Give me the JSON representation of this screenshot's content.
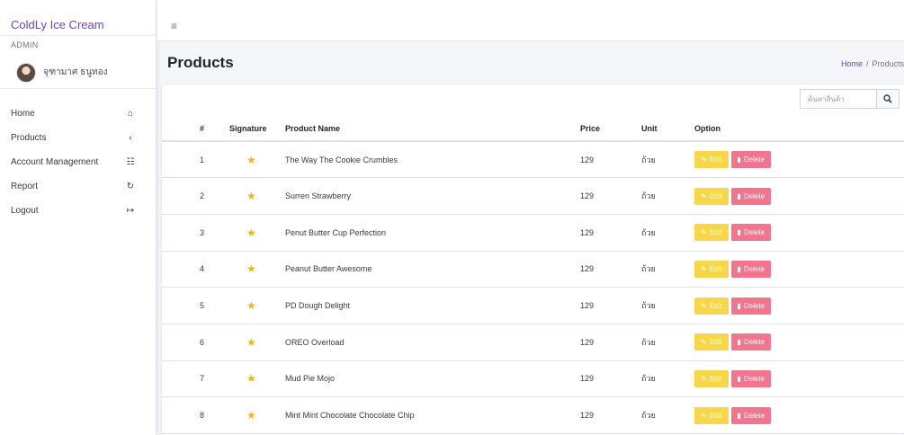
{
  "app": {
    "brand": "ColdLy Ice Cream"
  },
  "user": {
    "role": "ADMIN",
    "name": "จุฑามาศ ธนูทอง"
  },
  "sidebar": {
    "items": [
      {
        "label": "Home",
        "icon": "home-icon",
        "glyph": "⌂"
      },
      {
        "label": "Products",
        "icon": "chevron-left-icon",
        "glyph": "‹"
      },
      {
        "label": "Account Management",
        "icon": "users-icon",
        "glyph": "☷"
      },
      {
        "label": "Report",
        "icon": "history-icon",
        "glyph": "↻"
      },
      {
        "label": "Logout",
        "icon": "sign-out-icon",
        "glyph": "↦"
      }
    ]
  },
  "topbar": {
    "menu_icon": "hamburger-icon",
    "menu_glyph": "≡"
  },
  "page": {
    "title": "Products",
    "breadcrumb": {
      "home": "Home",
      "separator": "/",
      "current": "Products"
    }
  },
  "search": {
    "placeholder": "ค้นหาสินค้า",
    "value": ""
  },
  "table": {
    "headers": {
      "num": "#",
      "signature": "Signature",
      "name": "Product Name",
      "price": "Price",
      "unit": "Unit",
      "option": "Option"
    },
    "edit_label": "Edit",
    "delete_label": "Delete",
    "rows": [
      {
        "num": "1",
        "name": "The Way The Cookie Crumbles",
        "price": "129",
        "unit": "ถ้วย"
      },
      {
        "num": "2",
        "name": "Surren Strawberry",
        "price": "129",
        "unit": "ถ้วย"
      },
      {
        "num": "3",
        "name": "Penut Butter Cup Perfection",
        "price": "129",
        "unit": "ถ้วย"
      },
      {
        "num": "4",
        "name": "Peanut Butter Awesome",
        "price": "129",
        "unit": "ถ้วย"
      },
      {
        "num": "5",
        "name": "PD Dough Delight",
        "price": "129",
        "unit": "ถ้วย"
      },
      {
        "num": "6",
        "name": "OREO Overload",
        "price": "129",
        "unit": "ถ้วย"
      },
      {
        "num": "7",
        "name": "Mud Pie Mojo",
        "price": "129",
        "unit": "ถ้วย"
      },
      {
        "num": "8",
        "name": "Mint Mint Chocolate Chocolate Chip",
        "price": "129",
        "unit": "ถ้วย"
      }
    ]
  },
  "colors": {
    "accent": "#6f42c1",
    "edit": "#f7d64a",
    "delete": "#f2748d",
    "star": "#f2b705"
  }
}
